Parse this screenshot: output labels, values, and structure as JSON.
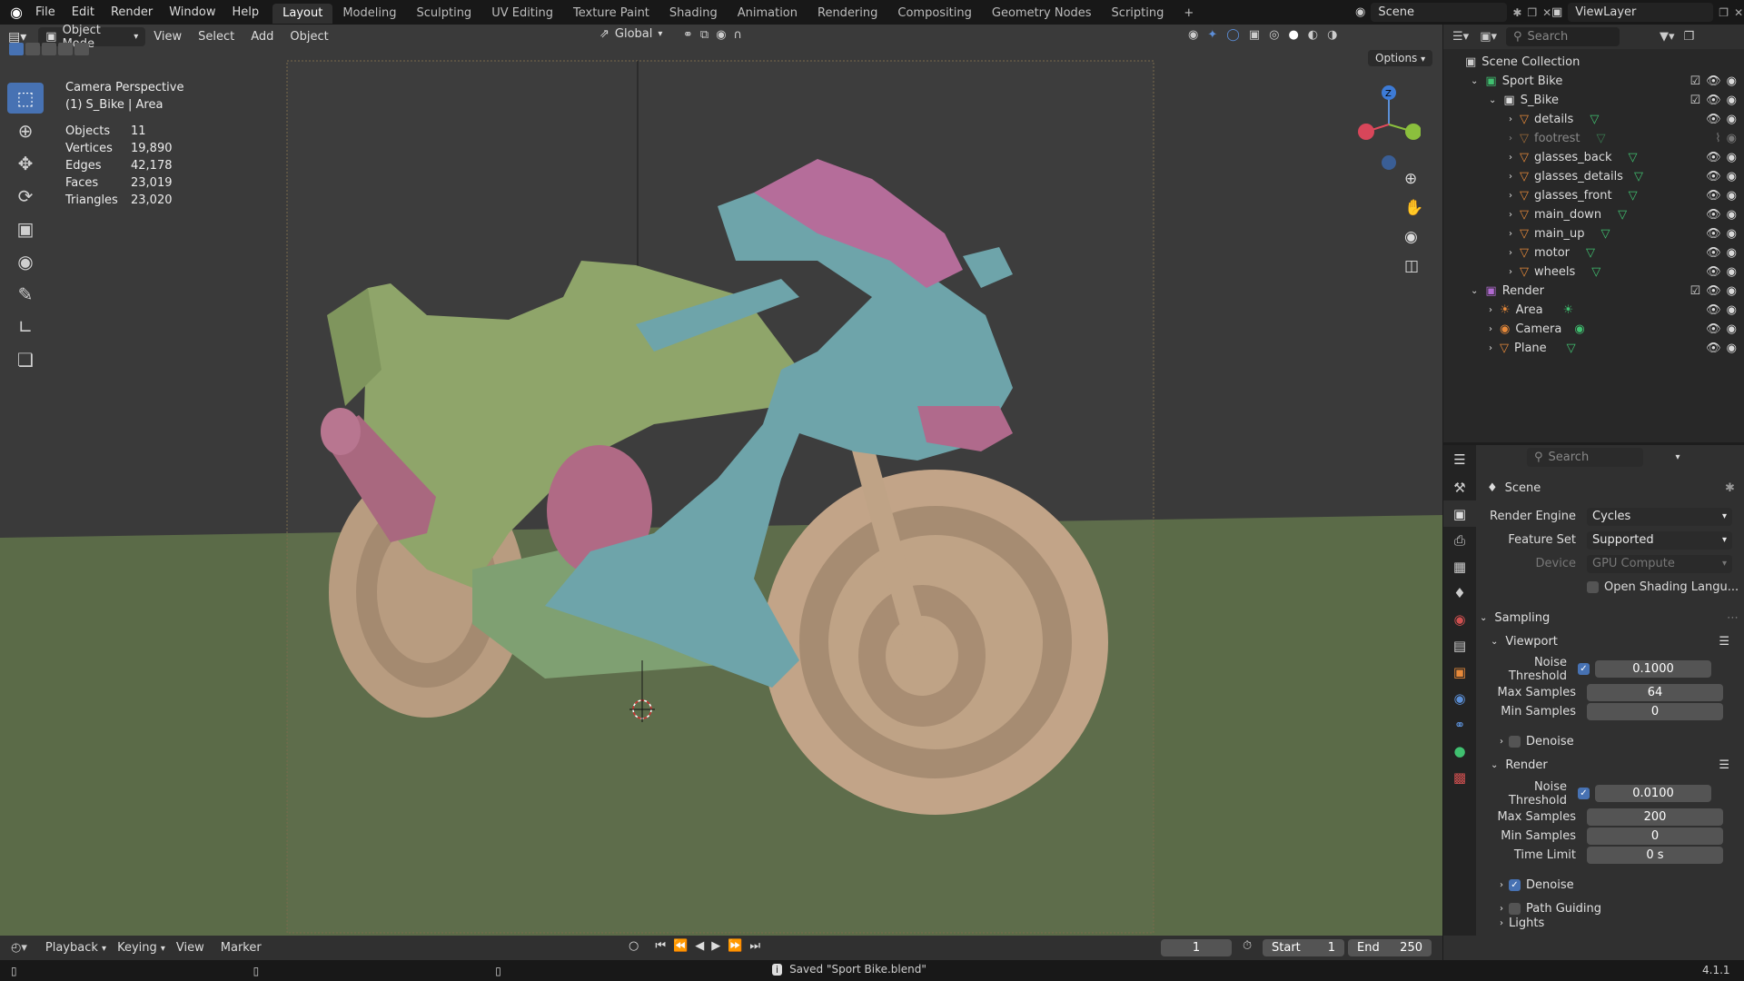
{
  "topbar": {
    "menus": [
      "File",
      "Edit",
      "Render",
      "Window",
      "Help"
    ],
    "workspaces": [
      "Layout",
      "Modeling",
      "Sculpting",
      "UV Editing",
      "Texture Paint",
      "Shading",
      "Animation",
      "Rendering",
      "Compositing",
      "Geometry Nodes",
      "Scripting"
    ],
    "active_workspace": "Layout",
    "add_tab": "+",
    "scene": "Scene",
    "view_layer": "ViewLayer"
  },
  "viewport": {
    "mode": "Object Mode",
    "menus": [
      "View",
      "Select",
      "Add",
      "Object"
    ],
    "orientation": "Global",
    "options": "Options",
    "overlay": {
      "title": "Camera Perspective",
      "subtitle": "(1) S_Bike | Area",
      "stats": [
        {
          "k": "Objects",
          "v": "11"
        },
        {
          "k": "Vertices",
          "v": "19,890"
        },
        {
          "k": "Edges",
          "v": "42,178"
        },
        {
          "k": "Faces",
          "v": "23,019"
        },
        {
          "k": "Triangles",
          "v": "23,020"
        }
      ]
    },
    "gizmo": {
      "z": "Z"
    }
  },
  "outliner": {
    "search_placeholder": "Search",
    "root": "Scene Collection",
    "items": [
      {
        "label": "Sport Bike",
        "type": "collection",
        "depth": 0
      },
      {
        "label": "S_Bike",
        "type": "collection",
        "depth": 1
      },
      {
        "label": "details",
        "type": "mesh",
        "depth": 2
      },
      {
        "label": "footrest",
        "type": "mesh",
        "depth": 2,
        "disabled": true
      },
      {
        "label": "glasses_back",
        "type": "mesh",
        "depth": 2
      },
      {
        "label": "glasses_details",
        "type": "mesh",
        "depth": 2
      },
      {
        "label": "glasses_front",
        "type": "mesh",
        "depth": 2
      },
      {
        "label": "main_down",
        "type": "mesh",
        "depth": 2
      },
      {
        "label": "main_up",
        "type": "mesh",
        "depth": 2
      },
      {
        "label": "motor",
        "type": "mesh",
        "depth": 2
      },
      {
        "label": "wheels",
        "type": "mesh",
        "depth": 2
      },
      {
        "label": "Render",
        "type": "collection",
        "depth": 0
      },
      {
        "label": "Area",
        "type": "light",
        "depth": 1
      },
      {
        "label": "Camera",
        "type": "camera",
        "depth": 1
      },
      {
        "label": "Plane",
        "type": "mesh",
        "depth": 1
      }
    ]
  },
  "properties": {
    "search_placeholder": "Search",
    "context": "Scene",
    "render_engine_label": "Render Engine",
    "render_engine": "Cycles",
    "feature_set_label": "Feature Set",
    "feature_set": "Supported",
    "device_label": "Device",
    "device": "GPU Compute",
    "osl_label": "Open Shading Langu...",
    "sampling": "Sampling",
    "viewport_section": "Viewport",
    "noise_threshold_label": "Noise Threshold",
    "vp_noise_threshold": "0.1000",
    "max_samples_label": "Max Samples",
    "vp_max_samples": "64",
    "min_samples_label": "Min Samples",
    "vp_min_samples": "0",
    "denoise_label": "Denoise",
    "render_section": "Render",
    "r_noise_threshold": "0.0100",
    "r_max_samples": "200",
    "r_min_samples": "0",
    "time_limit_label": "Time Limit",
    "r_time_limit": "0 s",
    "path_guiding_label": "Path Guiding",
    "lights_label": "Lights"
  },
  "timeline": {
    "menus": [
      "Playback",
      "Keying",
      "View",
      "Marker"
    ],
    "current_frame": "1",
    "start_label": "Start",
    "start": "1",
    "end_label": "End",
    "end": "250"
  },
  "statusbar": {
    "message": "Saved \"Sport Bike.blend\"",
    "version": "4.1.1"
  },
  "colors": {
    "accent": "#4772b3",
    "bike_green": "#8ea46a",
    "bike_teal": "#6fa5ab",
    "bike_pink": "#b06a8c",
    "bike_tan": "#bfa184",
    "ground": "#667a52"
  }
}
